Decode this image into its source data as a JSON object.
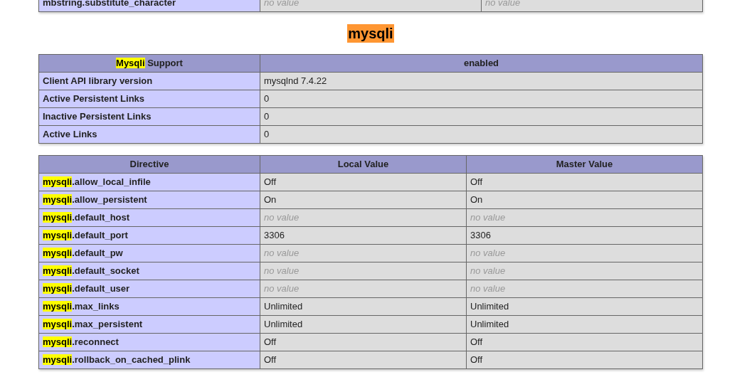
{
  "previous_table": {
    "rows": [
      {
        "name": [
          {
            "text": "mbstring.substitute_character",
            "highlight": false
          }
        ],
        "values": [
          {
            "text": "no value",
            "empty": true
          },
          {
            "text": "no value",
            "empty": true
          }
        ]
      }
    ]
  },
  "section_title": {
    "text": "mysqli",
    "highlight": true
  },
  "support_table": {
    "header": [
      [
        {
          "text": "Mysqli",
          "highlight": true
        },
        {
          "text": " Support",
          "highlight": false
        }
      ],
      [
        {
          "text": "enabled",
          "highlight": false
        }
      ]
    ],
    "rows": [
      {
        "name": "Client API library version",
        "value": "mysqlnd 7.4.22"
      },
      {
        "name": "Active Persistent Links",
        "value": "0"
      },
      {
        "name": "Inactive Persistent Links",
        "value": "0"
      },
      {
        "name": "Active Links",
        "value": "0"
      }
    ]
  },
  "directive_table": {
    "columns": [
      "Directive",
      "Local Value",
      "Master Value"
    ],
    "rows": [
      {
        "name": [
          {
            "text": "mysqli",
            "highlight": true
          },
          {
            "text": ".allow_local_infile",
            "highlight": false
          }
        ],
        "values": [
          {
            "text": "Off",
            "empty": false
          },
          {
            "text": "Off",
            "empty": false
          }
        ]
      },
      {
        "name": [
          {
            "text": "mysqli",
            "highlight": true
          },
          {
            "text": ".allow_persistent",
            "highlight": false
          }
        ],
        "values": [
          {
            "text": "On",
            "empty": false
          },
          {
            "text": "On",
            "empty": false
          }
        ]
      },
      {
        "name": [
          {
            "text": "mysqli",
            "highlight": true
          },
          {
            "text": ".default_host",
            "highlight": false
          }
        ],
        "values": [
          {
            "text": "no value",
            "empty": true
          },
          {
            "text": "no value",
            "empty": true
          }
        ]
      },
      {
        "name": [
          {
            "text": "mysqli",
            "highlight": true
          },
          {
            "text": ".default_port",
            "highlight": false
          }
        ],
        "values": [
          {
            "text": "3306",
            "empty": false
          },
          {
            "text": "3306",
            "empty": false
          }
        ]
      },
      {
        "name": [
          {
            "text": "mysqli",
            "highlight": true
          },
          {
            "text": ".default_pw",
            "highlight": false
          }
        ],
        "values": [
          {
            "text": "no value",
            "empty": true
          },
          {
            "text": "no value",
            "empty": true
          }
        ]
      },
      {
        "name": [
          {
            "text": "mysqli",
            "highlight": true
          },
          {
            "text": ".default_socket",
            "highlight": false
          }
        ],
        "values": [
          {
            "text": "no value",
            "empty": true
          },
          {
            "text": "no value",
            "empty": true
          }
        ]
      },
      {
        "name": [
          {
            "text": "mysqli",
            "highlight": true
          },
          {
            "text": ".default_user",
            "highlight": false
          }
        ],
        "values": [
          {
            "text": "no value",
            "empty": true
          },
          {
            "text": "no value",
            "empty": true
          }
        ]
      },
      {
        "name": [
          {
            "text": "mysqli",
            "highlight": true
          },
          {
            "text": ".max_links",
            "highlight": false
          }
        ],
        "values": [
          {
            "text": "Unlimited",
            "empty": false
          },
          {
            "text": "Unlimited",
            "empty": false
          }
        ]
      },
      {
        "name": [
          {
            "text": "mysqli",
            "highlight": true
          },
          {
            "text": ".max_persistent",
            "highlight": false
          }
        ],
        "values": [
          {
            "text": "Unlimited",
            "empty": false
          },
          {
            "text": "Unlimited",
            "empty": false
          }
        ]
      },
      {
        "name": [
          {
            "text": "mysqli",
            "highlight": true
          },
          {
            "text": ".reconnect",
            "highlight": false
          }
        ],
        "values": [
          {
            "text": "Off",
            "empty": false
          },
          {
            "text": "Off",
            "empty": false
          }
        ]
      },
      {
        "name": [
          {
            "text": "mysqli",
            "highlight": true
          },
          {
            "text": ".rollback_on_cached_plink",
            "highlight": false
          }
        ],
        "values": [
          {
            "text": "Off",
            "empty": false
          },
          {
            "text": "Off",
            "empty": false
          }
        ]
      }
    ]
  }
}
